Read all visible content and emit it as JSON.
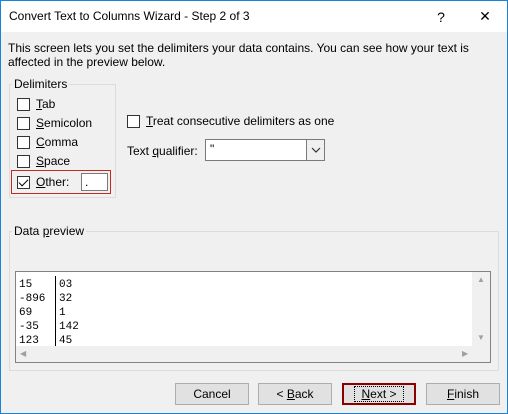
{
  "window": {
    "title": "Convert Text to Columns Wizard - Step 2 of 3"
  },
  "titlebar": {
    "help_glyph": "?",
    "close_glyph": "✕"
  },
  "intro": "This screen lets you set the delimiters your data contains.  You can see how your text is affected in the preview below.",
  "delimiters": {
    "label": "Delimiters",
    "items": [
      {
        "key": "T",
        "rest": "ab",
        "checked": false
      },
      {
        "key": "S",
        "rest": "emicolon",
        "checked": false
      },
      {
        "key": "C",
        "rest": "omma",
        "checked": false
      },
      {
        "key": "S",
        "rest": "pace",
        "checked": false
      },
      {
        "key": "O",
        "rest": "ther:",
        "checked": true
      }
    ],
    "other_value": "."
  },
  "options": {
    "consecutive_key": "T",
    "consecutive_rest": "reat consecutive delimiters as one",
    "consecutive_checked": false,
    "qualifier_label_pre": "Text ",
    "qualifier_label_key": "q",
    "qualifier_label_post": "ualifier:",
    "qualifier_value": "\""
  },
  "preview": {
    "label_pre": "Data ",
    "label_key": "p",
    "label_post": "review",
    "rows": [
      [
        "15",
        "03"
      ],
      [
        "-896",
        "32"
      ],
      [
        "69",
        "1"
      ],
      [
        "-35",
        "142"
      ],
      [
        "123",
        "45"
      ]
    ]
  },
  "buttons": {
    "cancel": "Cancel",
    "back_pre": "< ",
    "back_key": "B",
    "back_post": "ack",
    "next_key": "N",
    "next_post": "ext >",
    "finish_key": "F",
    "finish_post": "inish"
  }
}
